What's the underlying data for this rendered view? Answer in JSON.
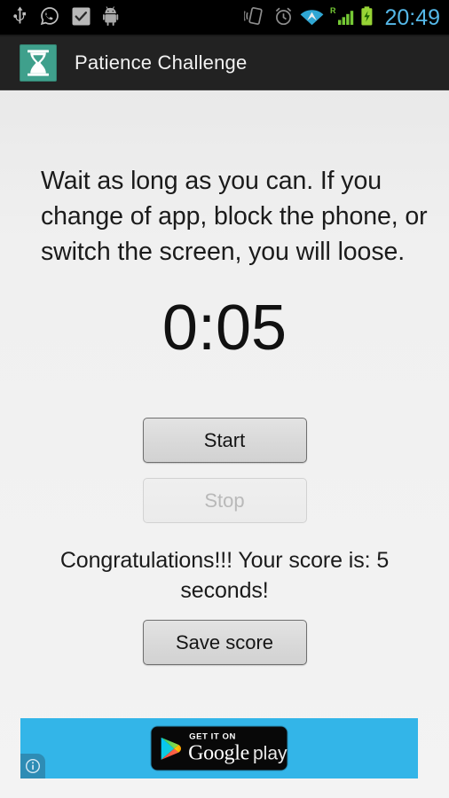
{
  "status_bar": {
    "background": "#000000",
    "time": "20:49",
    "time_color": "#55b8e8",
    "left_icons": [
      {
        "name": "usb-icon",
        "label": "USB connected"
      },
      {
        "name": "whatsapp-icon",
        "label": "WhatsApp notification"
      },
      {
        "name": "checkbox-icon",
        "label": "Task completed"
      },
      {
        "name": "android-robot-icon",
        "label": "Android system notification"
      }
    ],
    "right_icons": [
      {
        "name": "vibrate-icon",
        "label": "Vibrate mode"
      },
      {
        "name": "alarm-clock-icon",
        "label": "Alarm set"
      },
      {
        "name": "wifi-icon",
        "label": "Wi-Fi connected",
        "color": "#33b5e5"
      },
      {
        "name": "signal-bars-icon",
        "label": "Mobile signal roaming",
        "badge": "R",
        "color": "#7fdb3a"
      },
      {
        "name": "battery-charging-icon",
        "label": "Battery charging",
        "color": "#a4e63a"
      }
    ]
  },
  "action_bar": {
    "background": "#222222",
    "app_icon": {
      "name": "hourglass-icon",
      "background": "#3fa08c",
      "glyph_color": "#ffffff"
    },
    "title": "Patience Challenge"
  },
  "main": {
    "background": "#f0f0f0",
    "instructions": "Wait as long as you can. If you change of app, block the phone, or switch the screen, you will loose.",
    "timer": "0:05",
    "buttons": [
      {
        "id": "start",
        "label": "Start",
        "enabled": true
      },
      {
        "id": "stop",
        "label": "Stop",
        "enabled": false
      }
    ],
    "score_message": "Congratulations!!! Your score is: 5 seconds!",
    "save_button": {
      "label": "Save score",
      "enabled": true
    }
  },
  "ad": {
    "background": "#33b5e8",
    "badge": {
      "get_it_on": "GET IT ON",
      "google": "Google",
      "play": "play",
      "background": "#080808"
    },
    "info_icon": "ad-info-icon"
  }
}
